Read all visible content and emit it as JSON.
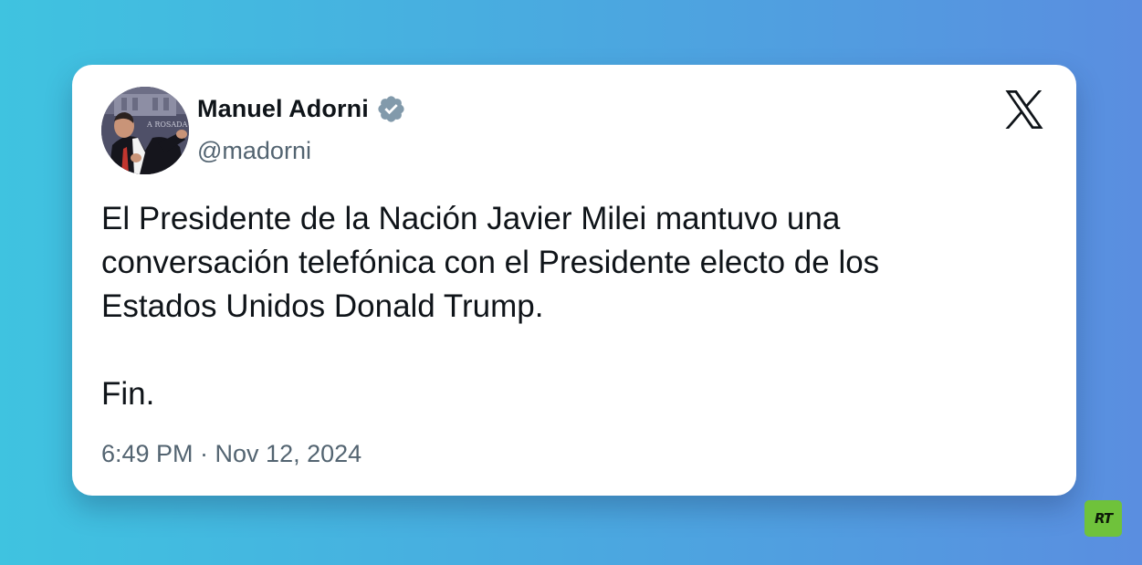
{
  "tweet": {
    "author": {
      "name": "Manuel Adorni",
      "handle": "@madorni",
      "verified": true,
      "avatar_icon": "profile-photo",
      "avatar_backdrop_text": "A ROSADA"
    },
    "text_lines": [
      "El Presidente de la Nación Javier Milei mantuvo una",
      "conversación telefónica con el Presidente electo de los",
      "Estados Unidos Donald Trump."
    ],
    "closing": "Fin.",
    "timestamp": "6:49 PM · Nov 12, 2024",
    "platform_icon": "x-logo-icon"
  },
  "watermark": {
    "label": "RT",
    "color": "#6fc23b"
  },
  "colors": {
    "background_start": "#3fc3e0",
    "background_end": "#5a8ee0",
    "verified_badge": "#829aab",
    "primary_text": "#0f1419",
    "secondary_text": "#536471"
  }
}
